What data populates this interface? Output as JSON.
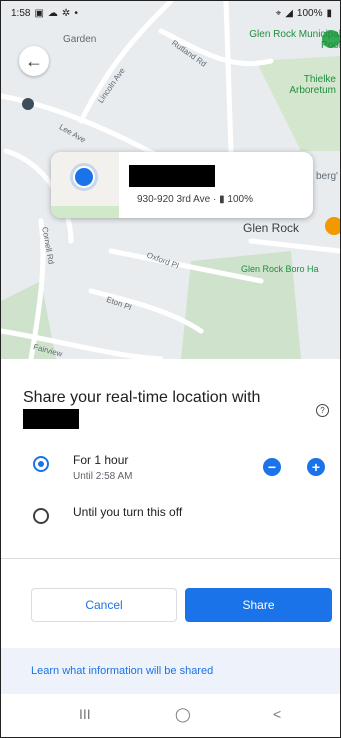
{
  "status_bar": {
    "time": "1:58",
    "left_icons": [
      "image-icon",
      "cloud-icon",
      "gear-icon",
      "dot-icon"
    ],
    "battery": "100%"
  },
  "map": {
    "labels": {
      "garden": "Garden",
      "rutland": "Rutland Rd",
      "glen_rock_pool": "Glen Rock Municipal Pool",
      "lincoln": "Lincoln Ave",
      "thielke": "Thielke Arboretum",
      "lee": "Lee Ave",
      "berg": "berg'",
      "glen_rock": "Glen Rock",
      "cornell": "Cornell Rd",
      "oxford": "Oxford Pl",
      "boro": "Glen Rock Boro Ha",
      "eton": "Eton Pl",
      "fairview": "Fairview"
    }
  },
  "location_card": {
    "address": "930-920 3rd Ave",
    "separator": "·",
    "battery": "100%"
  },
  "sheet": {
    "title": "Share your real-time location with",
    "options": [
      {
        "label": "For 1 hour",
        "sub": "Until 2:58 AM",
        "checked": true
      },
      {
        "label": "Until you turn this off",
        "sub": "",
        "checked": false
      }
    ],
    "cancel_label": "Cancel",
    "share_label": "Share",
    "learn_link": "Learn what information will be shared",
    "minus": "−",
    "plus": "+"
  },
  "nav": {
    "recents": "III",
    "home": "◯",
    "back": "<"
  },
  "colors": {
    "accent": "#1a73e8",
    "map_bg": "#e9ecef",
    "learn_bg": "#eef3fb"
  }
}
